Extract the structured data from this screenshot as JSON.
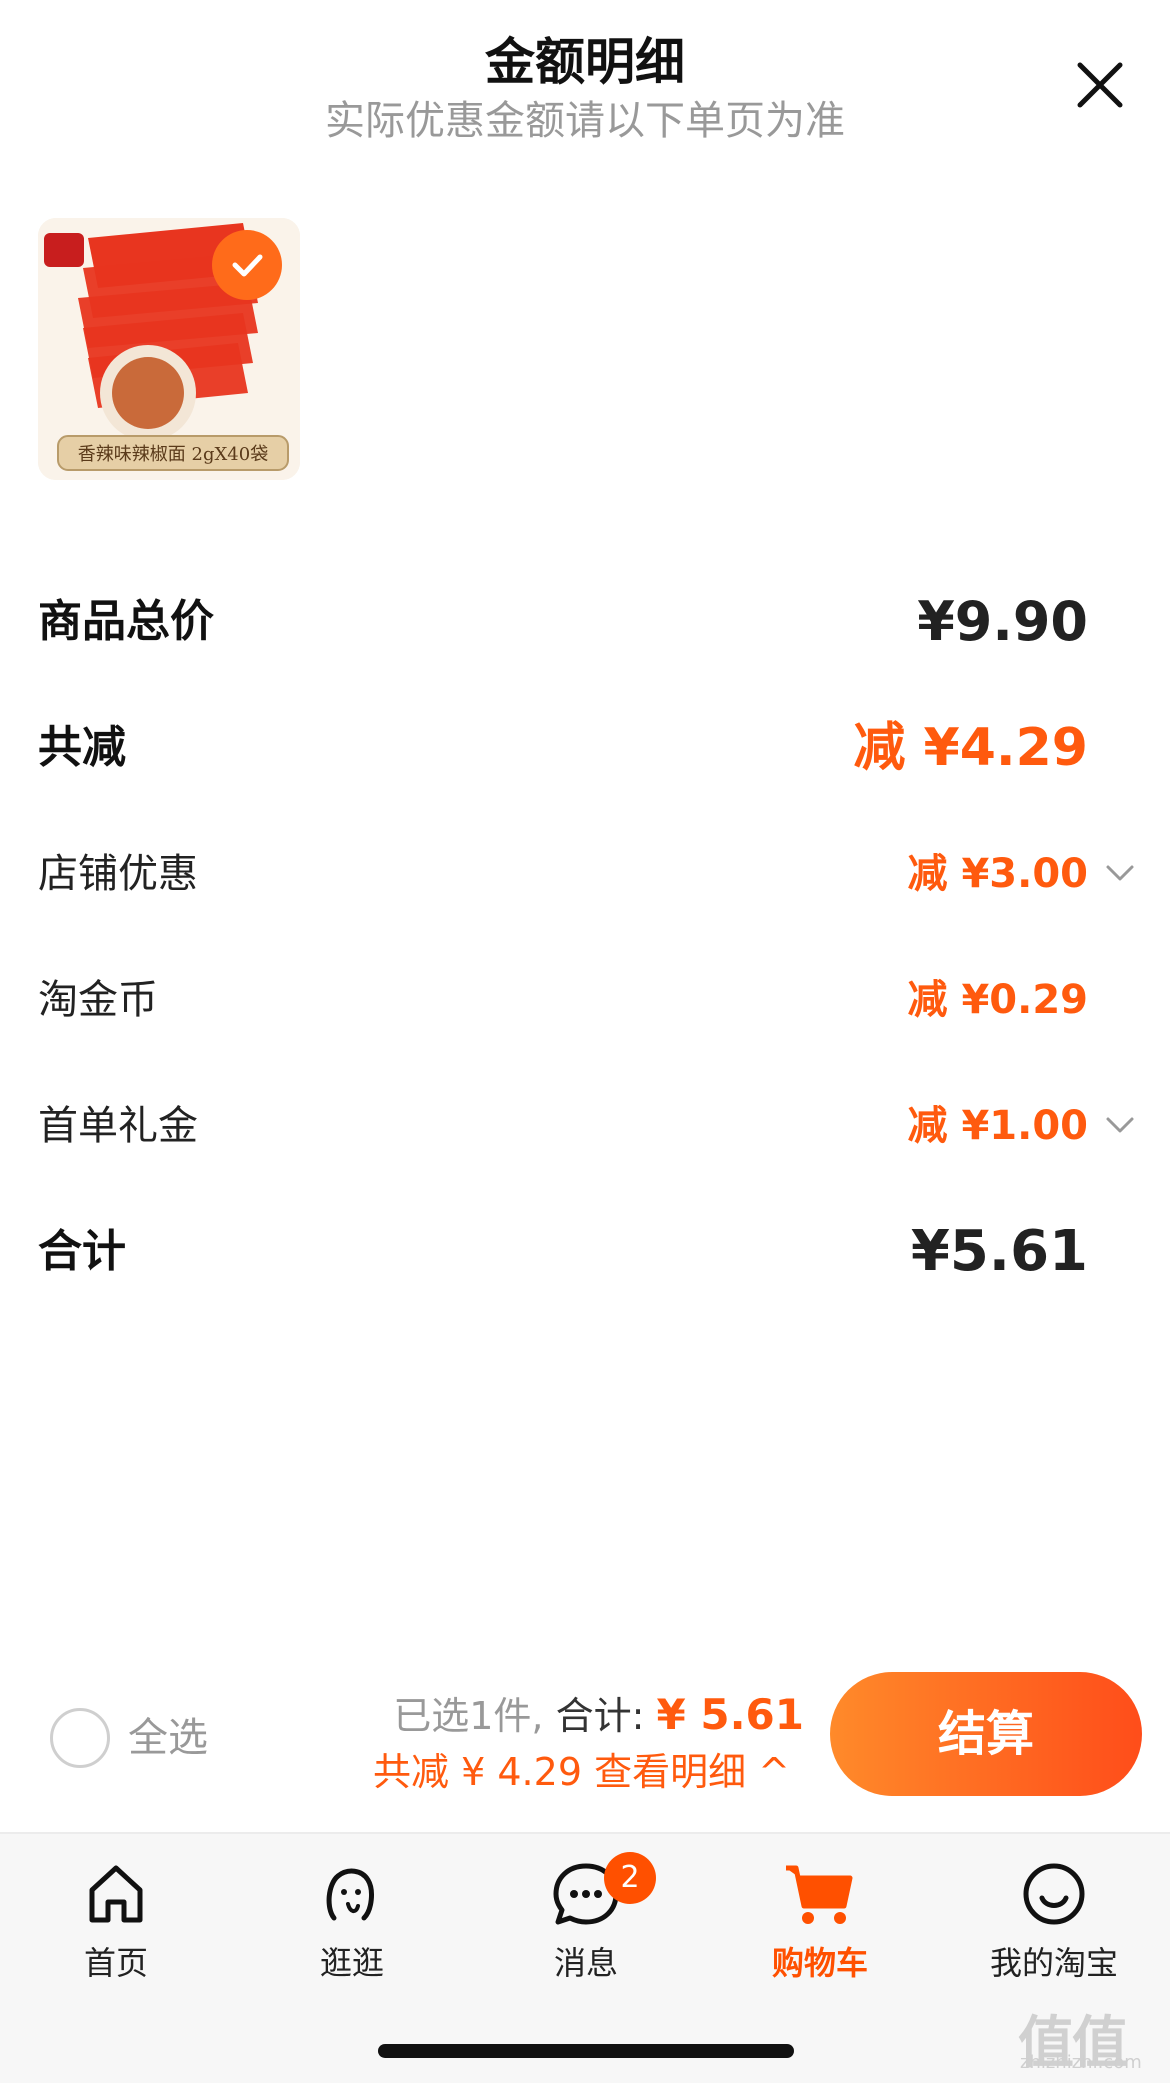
{
  "header": {
    "title": "金额明细",
    "subtitle": "实际优惠金额请以下单页为准"
  },
  "product": {
    "image_caption": "香辣味辣椒面 2gX40袋"
  },
  "rows": {
    "total_price": {
      "label": "商品总价",
      "value": "¥9.90"
    },
    "total_discount": {
      "label": "共减",
      "value": "减 ¥4.29"
    },
    "shop_discount": {
      "label": "店铺优惠",
      "value": "减 ¥3.00"
    },
    "taojinbi": {
      "label": "淘金币",
      "value": "减 ¥0.29"
    },
    "first_order_gift": {
      "label": "首单礼金",
      "value": "减 ¥1.00"
    },
    "total": {
      "label": "合计",
      "value": "¥5.61"
    }
  },
  "bottom_bar": {
    "select_all": "全选",
    "selected": "已选1件,",
    "total_label": "合计:",
    "total_amount": "¥ 5.61",
    "discount_text": "共减 ¥ 4.29  查看明细 ^",
    "checkout": "结算"
  },
  "tabbar": {
    "tabs": [
      {
        "label": "首页",
        "icon": "home-icon"
      },
      {
        "label": "逛逛",
        "icon": "browse-icon"
      },
      {
        "label": "消息",
        "icon": "message-icon",
        "badge": "2"
      },
      {
        "label": "购物车",
        "icon": "cart-icon"
      },
      {
        "label": "我的淘宝",
        "icon": "smile-profile-icon"
      }
    ],
    "active": "购物车"
  },
  "watermark": {
    "logo": "值值值",
    "url": "zhizhizhi.com"
  },
  "colors": {
    "accent": "#ff5000",
    "discount": "#ff5a0e",
    "checkout_gradient_start": "#ff8a2a",
    "checkout_gradient_end": "#ff4d1a",
    "muted": "#999999"
  }
}
